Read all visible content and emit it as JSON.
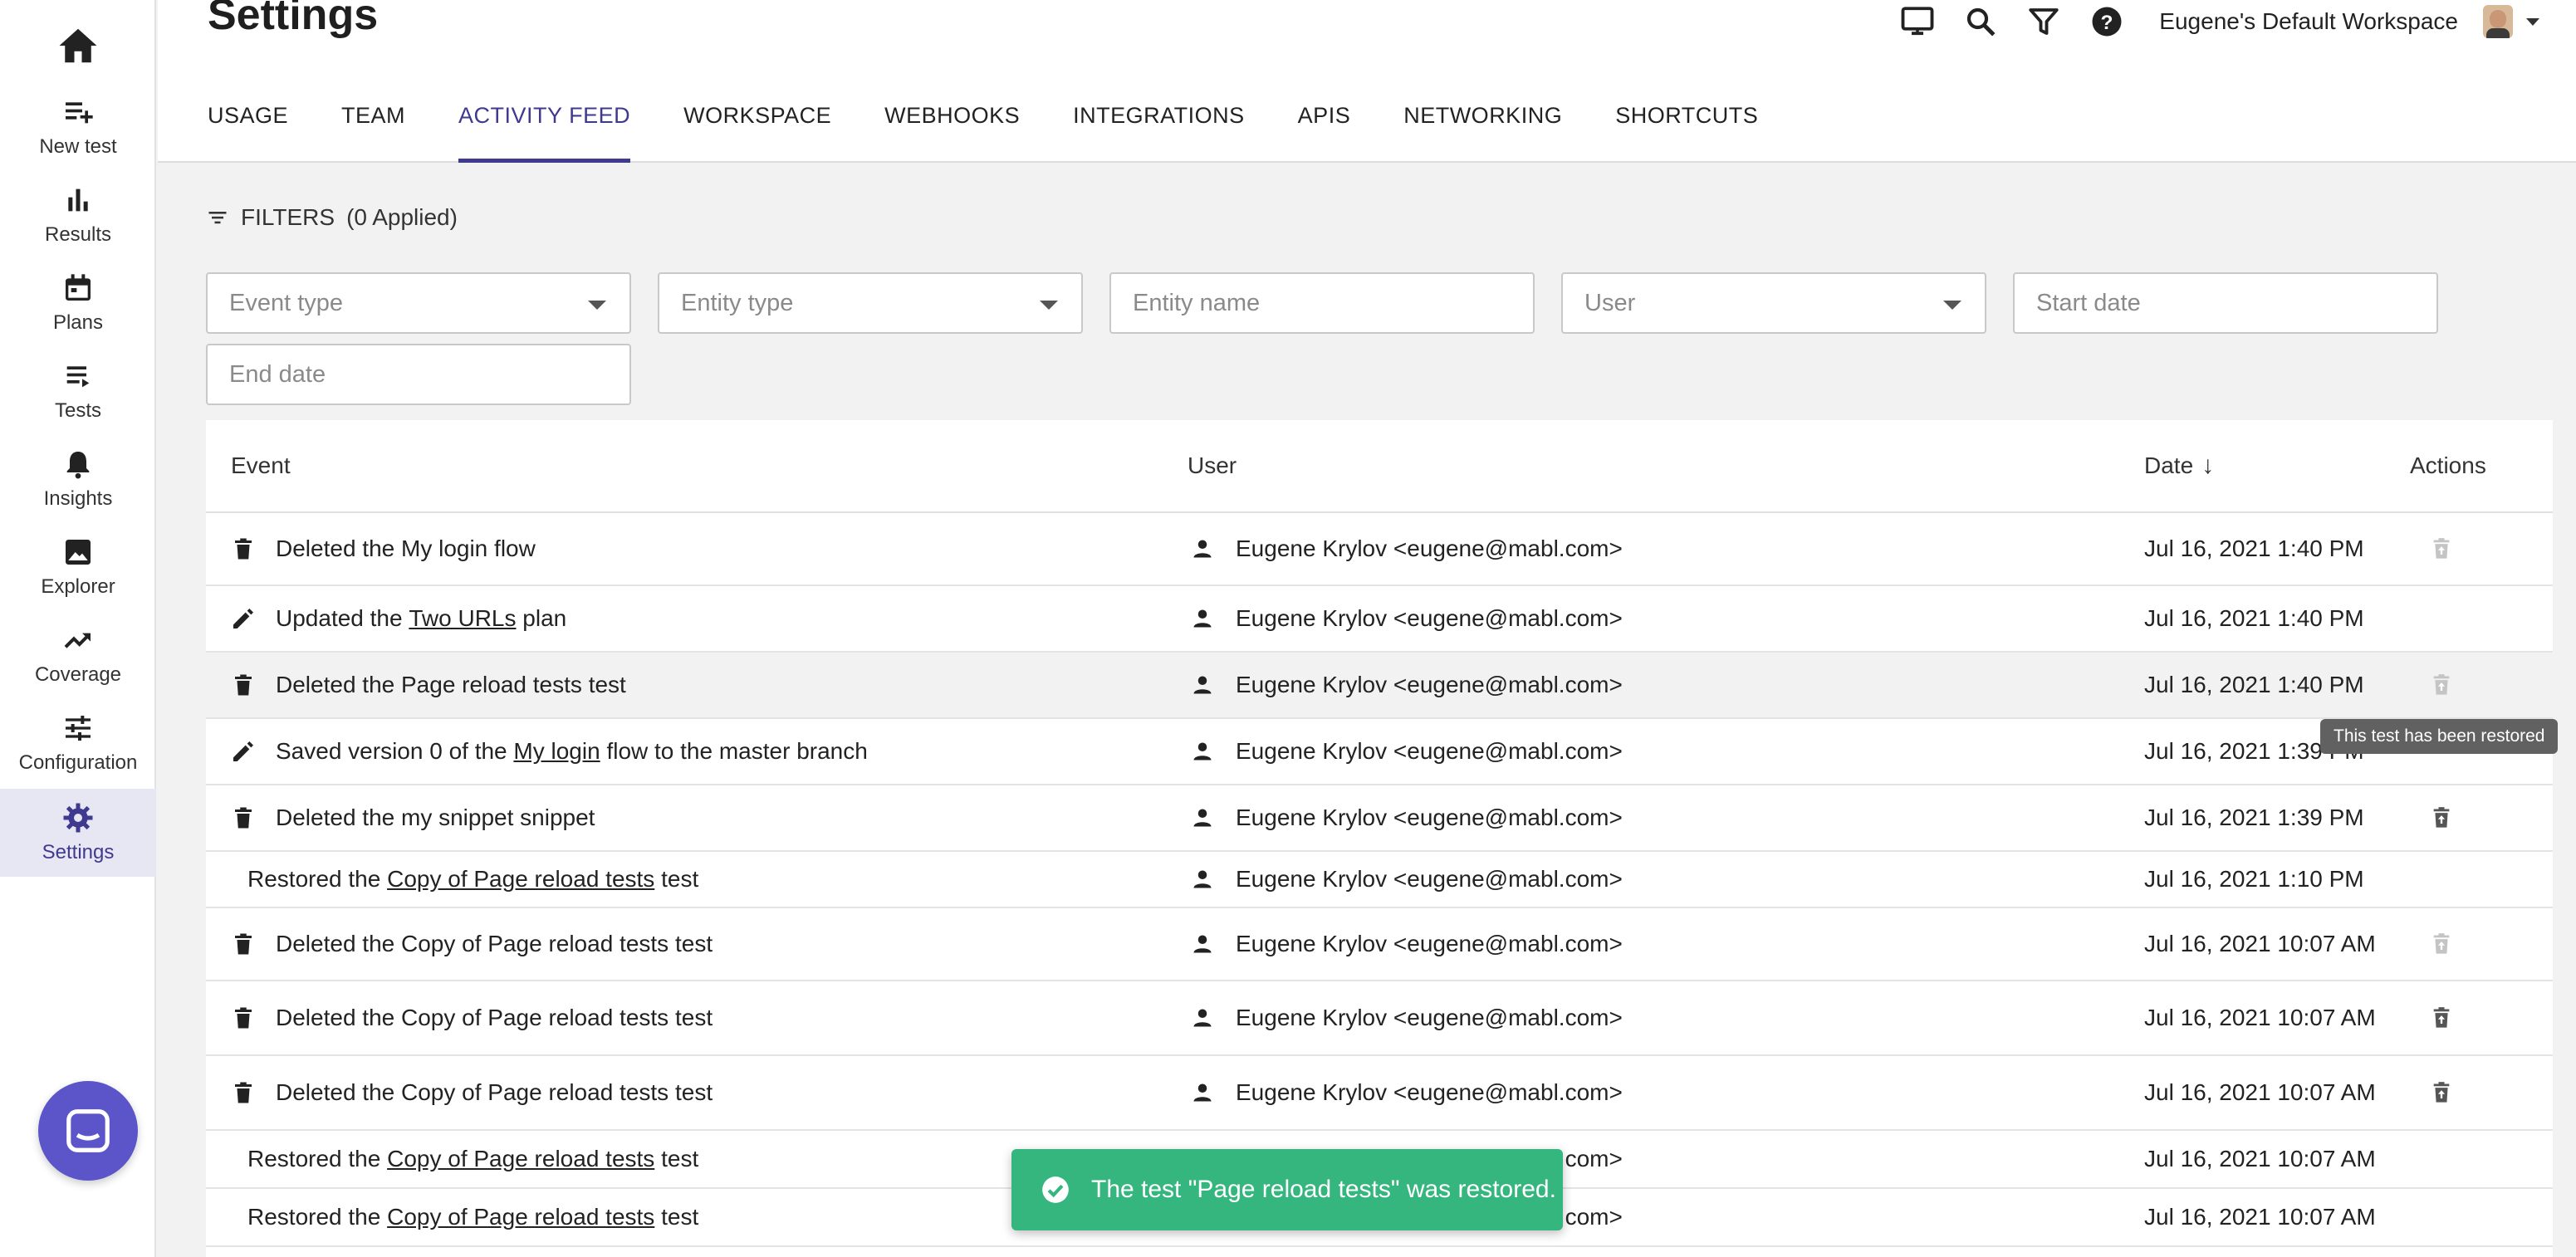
{
  "app": {
    "title": "Settings",
    "workspace": "Eugene's Default Workspace",
    "accent": "#3f3a8f"
  },
  "sidebar": {
    "home_icon": "home-icon",
    "items": [
      {
        "label": "New test",
        "icon": "playlist-add-icon"
      },
      {
        "label": "Results",
        "icon": "bar-chart-icon"
      },
      {
        "label": "Plans",
        "icon": "calendar-icon"
      },
      {
        "label": "Tests",
        "icon": "list-icon"
      },
      {
        "label": "Insights",
        "icon": "bell-icon"
      },
      {
        "label": "Explorer",
        "icon": "image-icon"
      },
      {
        "label": "Coverage",
        "icon": "trending-up-icon"
      },
      {
        "label": "Configuration",
        "icon": "tune-icon"
      },
      {
        "label": "Settings",
        "icon": "gear-icon",
        "active": true
      }
    ]
  },
  "header": {
    "tools": [
      "monitor-icon",
      "search-icon",
      "filter-icon",
      "help-icon"
    ],
    "tabs": [
      "USAGE",
      "TEAM",
      "ACTIVITY FEED",
      "WORKSPACE",
      "WEBHOOKS",
      "INTEGRATIONS",
      "APIS",
      "NETWORKING",
      "SHORTCUTS"
    ],
    "active_tab": "ACTIVITY FEED"
  },
  "filters": {
    "title": "FILTERS",
    "applied": "(0 Applied)",
    "event_type": "Event type",
    "entity_type": "Entity type",
    "entity_name": "Entity name",
    "user": "User",
    "start_date": "Start date",
    "end_date": "End date"
  },
  "table": {
    "columns": {
      "event": "Event",
      "user": "User",
      "date": "Date",
      "actions": "Actions"
    },
    "sort_indicator": "↓",
    "rows": [
      {
        "icon": "trash-icon",
        "pre": "Deleted the My login flow",
        "link": "",
        "post": "",
        "user": "Eugene Krylov <eugene@mabl.com>",
        "date": "Jul 16, 2021 1:40 PM",
        "action": "restore-disabled"
      },
      {
        "icon": "pencil-icon",
        "pre": "Updated the ",
        "link": "Two URLs",
        "post": " plan",
        "user": "Eugene Krylov <eugene@mabl.com>",
        "date": "Jul 16, 2021 1:40 PM",
        "action": "none"
      },
      {
        "icon": "trash-icon",
        "pre": "Deleted the Page reload tests test",
        "link": "",
        "post": "",
        "user": "Eugene Krylov <eugene@mabl.com>",
        "date": "Jul 16, 2021 1:40 PM",
        "action": "restore-disabled",
        "hover": true
      },
      {
        "icon": "pencil-icon",
        "pre": "Saved version 0 of the ",
        "link": "My login",
        "post": " flow to the master branch",
        "user": "Eugene Krylov <eugene@mabl.com>",
        "date": "Jul 16, 2021 1:39 PM",
        "action": "none"
      },
      {
        "icon": "trash-icon",
        "pre": "Deleted the my snippet snippet",
        "link": "",
        "post": "",
        "user": "Eugene Krylov <eugene@mabl.com>",
        "date": "Jul 16, 2021 1:39 PM",
        "action": "restore"
      },
      {
        "icon": "",
        "pre": "Restored the ",
        "link": "Copy of Page reload tests",
        "post": " test",
        "user": "Eugene Krylov <eugene@mabl.com>",
        "date": "Jul 16, 2021 1:10 PM",
        "action": "none"
      },
      {
        "icon": "trash-icon",
        "pre": "Deleted the Copy of Page reload tests test",
        "link": "",
        "post": "",
        "user": "Eugene Krylov <eugene@mabl.com>",
        "date": "Jul 16, 2021 10:07 AM",
        "action": "restore-disabled"
      },
      {
        "icon": "trash-icon",
        "pre": "Deleted the Copy of Page reload tests test",
        "link": "",
        "post": "",
        "user": "Eugene Krylov <eugene@mabl.com>",
        "date": "Jul 16, 2021 10:07 AM",
        "action": "restore"
      },
      {
        "icon": "trash-icon",
        "pre": "Deleted the Copy of Page reload tests test",
        "link": "",
        "post": "",
        "user": "Eugene Krylov <eugene@mabl.com>",
        "date": "Jul 16, 2021 10:07 AM",
        "action": "restore"
      },
      {
        "icon": "",
        "pre": "Restored the ",
        "link": "Copy of Page reload tests",
        "post": " test",
        "user": "Eugene Krylov <eugene@mabl.com>",
        "date": "Jul 16, 2021 10:07 AM",
        "action": "none"
      },
      {
        "icon": "",
        "pre": "Restored the ",
        "link": "Copy of Page reload tests",
        "post": " test",
        "user": "Eugene Krylov <eugene@mabl.com>",
        "date": "Jul 16, 2021 10:07 AM",
        "action": "none"
      }
    ]
  },
  "tooltip": "This test has been restored",
  "toast": {
    "message": "The test \"Page reload tests\" was restored.",
    "icon": "check-circle-icon",
    "color": "#34b67e"
  }
}
